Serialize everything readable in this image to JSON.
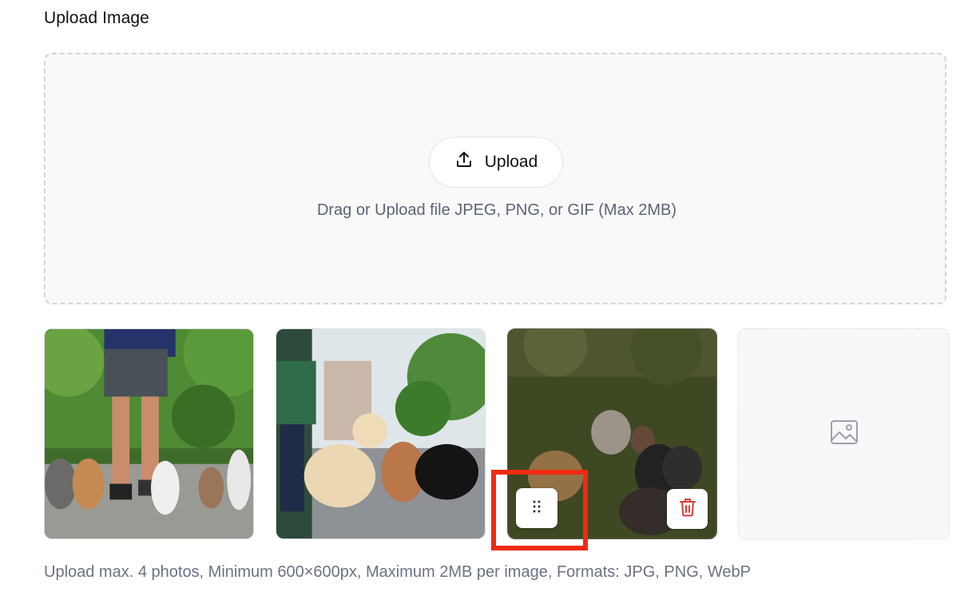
{
  "section": {
    "title": "Upload Image"
  },
  "dropzone": {
    "upload_label": "Upload",
    "upload_icon": "upload-icon",
    "hint": "Drag or Upload file JPEG, PNG, or GIF (Max 2MB)"
  },
  "gallery": {
    "photos": [
      {
        "icon": "photo-dog-walker-many-dogs"
      },
      {
        "icon": "photo-woman-walking-dogs"
      },
      {
        "icon": "photo-dogs-on-grass"
      }
    ],
    "placeholder_icon": "image-placeholder-icon",
    "drag_handle_icon": "drag-handle-icon",
    "delete_icon": "trash-icon"
  },
  "footer": {
    "text": "Upload max. 4 photos, Minimum 600×600px, Maximum 2MB per image, Formats: JPG, PNG, WebP"
  },
  "colors": {
    "highlight": "#f02a12",
    "delete": "#dc3b3b",
    "hint_text": "#5b6475"
  }
}
